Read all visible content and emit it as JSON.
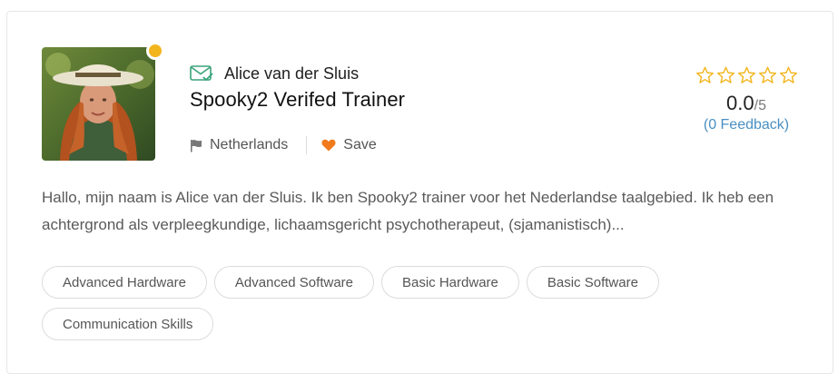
{
  "profile": {
    "name": "Alice van der Sluis",
    "headline": "Spooky2 Verifed Trainer",
    "country": "Netherlands",
    "save_label": "Save",
    "status_color": "#f2b51c"
  },
  "rating": {
    "stars_filled": 0,
    "stars_total": 5,
    "score": "0.0",
    "out_of": "/5",
    "feedback": "(0 Feedback)"
  },
  "bio": "Hallo, mijn naam is Alice van  der Sluis. Ik ben Spooky2 trainer voor het Nederlandse taalgebied. Ik heb een achtergrond als verpleegkundige, lichaamsgericht psychotherapeut, (sjamanistisch)...",
  "tags": [
    "Advanced Hardware",
    "Advanced Software",
    "Basic Hardware",
    "Basic Software",
    "Communication Skills"
  ],
  "icons": {
    "verified": "mail-check-icon",
    "country": "flag-icon",
    "save": "heart-icon",
    "star": "star-outline-icon"
  },
  "colors": {
    "accent_green": "#3aa37a",
    "star": "#f2b51c",
    "heart": "#f07a1c",
    "link": "#4a90c2"
  }
}
